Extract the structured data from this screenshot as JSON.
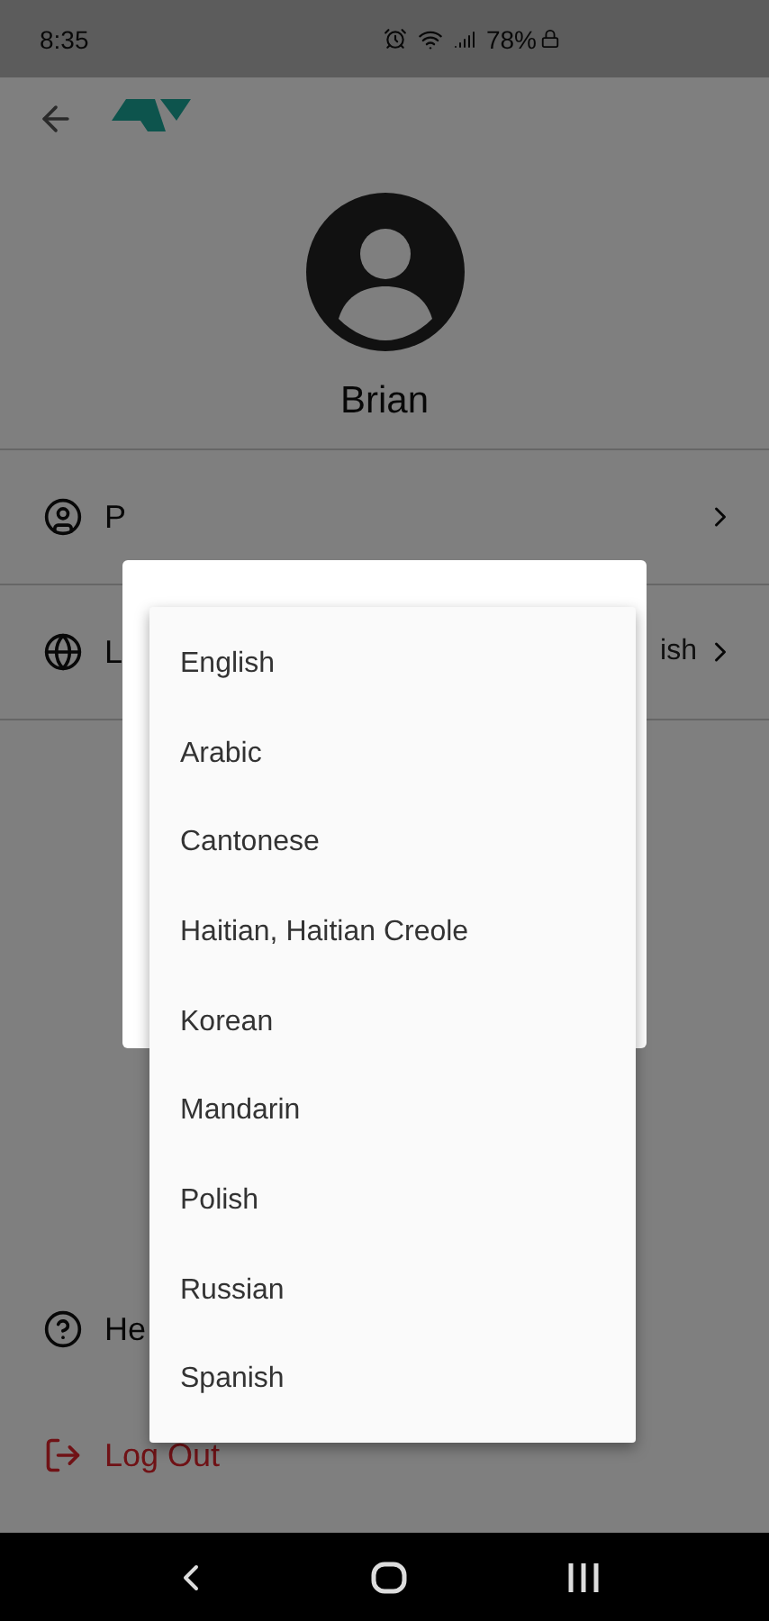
{
  "status_bar": {
    "time": "8:35",
    "battery": "78%"
  },
  "profile": {
    "name": "Brian"
  },
  "menu_rows": [
    {
      "kind": "profile",
      "label": "P"
    },
    {
      "kind": "language",
      "label": "L",
      "value": "ish"
    }
  ],
  "help": {
    "label": "He"
  },
  "logout": {
    "label": "Log Out"
  },
  "language_menu": {
    "options": [
      "English",
      "Arabic",
      "Cantonese",
      "Haitian, Haitian Creole",
      "Korean",
      "Mandarin",
      "Polish",
      "Russian",
      "Spanish"
    ]
  }
}
